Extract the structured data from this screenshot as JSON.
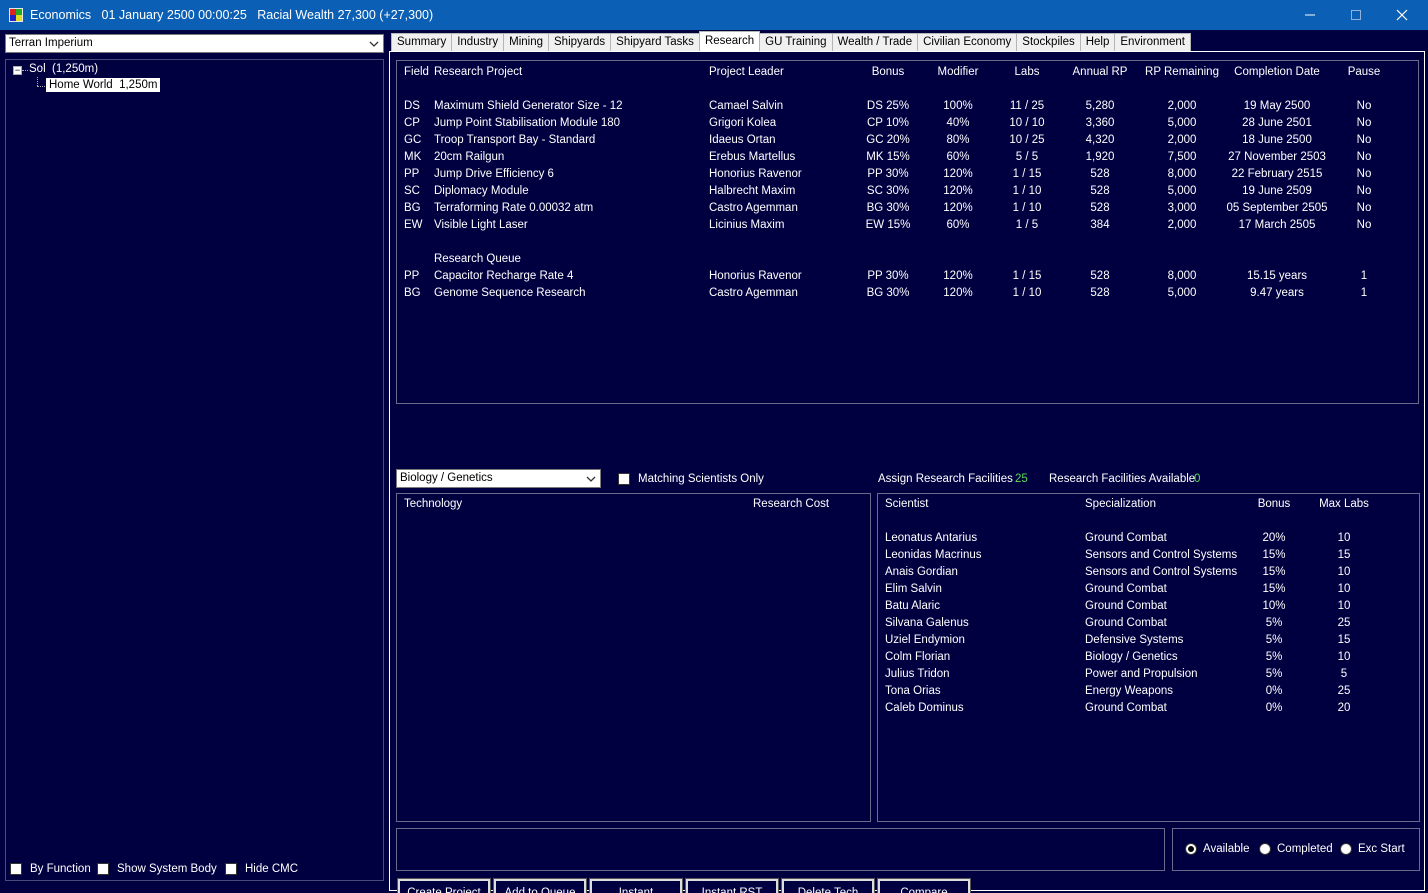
{
  "window": {
    "title": "Economics   01 January 2500 00:00:25   Racial Wealth 27,300 (+27,300)",
    "icons": [
      "app-icon",
      "minimize-icon",
      "maximize-icon",
      "close-icon"
    ]
  },
  "left": {
    "empire": "Terran Imperium",
    "tree": {
      "root_toggle": "−",
      "root": "Sol  (1,250m)",
      "child": "Home World  1,250m"
    },
    "checkboxes": {
      "by_function": "By Function",
      "show_system_body": "Show System Body",
      "hide_cmc": "Hide CMC"
    }
  },
  "tabs": [
    "Summary",
    "Industry",
    "Mining",
    "Shipyards",
    "Shipyard Tasks",
    "Research",
    "GU Training",
    "Wealth / Trade",
    "Civilian Economy",
    "Stockpiles",
    "Help",
    "Environment"
  ],
  "active_tab": "Research",
  "projects": {
    "headers": {
      "field": "Field",
      "project": "Research Project",
      "leader": "Project Leader",
      "bonus": "Bonus",
      "modifier": "Modifier",
      "labs": "Labs",
      "annual_rp": "Annual RP",
      "rp_remaining": "RP Remaining",
      "completion": "Completion Date",
      "pause": "Pause"
    },
    "rows": [
      {
        "field": "DS",
        "project": "Maximum Shield Generator Size - 12",
        "leader": "Camael Salvin",
        "bonus": "DS 25%",
        "modifier": "100%",
        "labs": "11 / 25",
        "annual_rp": "5,280",
        "rp_remaining": "2,000",
        "completion": "19 May 2500",
        "pause": "No"
      },
      {
        "field": "CP",
        "project": "Jump Point Stabilisation Module 180",
        "leader": "Grigori Kolea",
        "bonus": "CP 10%",
        "modifier": "40%",
        "labs": "10 / 10",
        "annual_rp": "3,360",
        "rp_remaining": "5,000",
        "completion": "28 June 2501",
        "pause": "No"
      },
      {
        "field": "GC",
        "project": "Troop Transport Bay - Standard",
        "leader": "Idaeus Ortan",
        "bonus": "GC 20%",
        "modifier": "80%",
        "labs": "10 / 25",
        "annual_rp": "4,320",
        "rp_remaining": "2,000",
        "completion": "18 June 2500",
        "pause": "No"
      },
      {
        "field": "MK",
        "project": "20cm Railgun",
        "leader": "Erebus Martellus",
        "bonus": "MK 15%",
        "modifier": "60%",
        "labs": "5 / 5",
        "annual_rp": "1,920",
        "rp_remaining": "7,500",
        "completion": "27 November 2503",
        "pause": "No"
      },
      {
        "field": "PP",
        "project": "Jump Drive Efficiency 6",
        "leader": "Honorius Ravenor",
        "bonus": "PP 30%",
        "modifier": "120%",
        "labs": "1 / 15",
        "annual_rp": "528",
        "rp_remaining": "8,000",
        "completion": "22 February 2515",
        "pause": "No"
      },
      {
        "field": "SC",
        "project": "Diplomacy Module",
        "leader": "Halbrecht Maxim",
        "bonus": "SC 30%",
        "modifier": "120%",
        "labs": "1 / 10",
        "annual_rp": "528",
        "rp_remaining": "5,000",
        "completion": "19 June 2509",
        "pause": "No"
      },
      {
        "field": "BG",
        "project": "Terraforming Rate 0.00032 atm",
        "leader": "Castro Agemman",
        "bonus": "BG 30%",
        "modifier": "120%",
        "labs": "1 / 10",
        "annual_rp": "528",
        "rp_remaining": "3,000",
        "completion": "05 September 2505",
        "pause": "No"
      },
      {
        "field": "EW",
        "project": "Visible Light Laser",
        "leader": "Licinius Maxim",
        "bonus": "EW 15%",
        "modifier": "60%",
        "labs": "1 / 5",
        "annual_rp": "384",
        "rp_remaining": "2,000",
        "completion": "17 March 2505",
        "pause": "No"
      }
    ],
    "queue_label": "Research Queue",
    "queue": [
      {
        "field": "PP",
        "project": "Capacitor Recharge Rate 4",
        "leader": "Honorius Ravenor",
        "bonus": "PP 30%",
        "modifier": "120%",
        "labs": "1 / 15",
        "annual_rp": "528",
        "rp_remaining": "8,000",
        "completion": "15.15 years",
        "pause": "1"
      },
      {
        "field": "BG",
        "project": "Genome Sequence Research",
        "leader": "Castro Agemman",
        "bonus": "BG 30%",
        "modifier": "120%",
        "labs": "1 / 10",
        "annual_rp": "528",
        "rp_remaining": "5,000",
        "completion": "9.47 years",
        "pause": "1"
      }
    ]
  },
  "controls": {
    "field_select": "Biology / Genetics",
    "matching_only": "Matching Scientists Only",
    "assign_label": "Assign Research Facilities",
    "assign_value": "25",
    "available_label": "Research Facilities Available",
    "available_value": "0",
    "value_color": "#55dd55"
  },
  "tech": {
    "headers": {
      "technology": "Technology",
      "cost": "Research Cost"
    },
    "rows": []
  },
  "scientists": {
    "headers": {
      "name": "Scientist",
      "spec": "Specialization",
      "bonus": "Bonus",
      "max_labs": "Max Labs"
    },
    "rows": [
      {
        "name": "Leonatus Antarius",
        "spec": "Ground Combat",
        "bonus": "20%",
        "max_labs": "10"
      },
      {
        "name": "Leonidas Macrinus",
        "spec": "Sensors and Control Systems",
        "bonus": "15%",
        "max_labs": "15"
      },
      {
        "name": "Anais Gordian",
        "spec": "Sensors and Control Systems",
        "bonus": "15%",
        "max_labs": "10"
      },
      {
        "name": "Elim Salvin",
        "spec": "Ground Combat",
        "bonus": "15%",
        "max_labs": "10"
      },
      {
        "name": "Batu Alaric",
        "spec": "Ground Combat",
        "bonus": "10%",
        "max_labs": "10"
      },
      {
        "name": "Silvana Galenus",
        "spec": "Ground Combat",
        "bonus": "5%",
        "max_labs": "25"
      },
      {
        "name": "Uziel Endymion",
        "spec": "Defensive Systems",
        "bonus": "5%",
        "max_labs": "15"
      },
      {
        "name": "Colm Florian",
        "spec": "Biology / Genetics",
        "bonus": "5%",
        "max_labs": "10"
      },
      {
        "name": "Julius Tridon",
        "spec": "Power and Propulsion",
        "bonus": "5%",
        "max_labs": "5"
      },
      {
        "name": "Tona Orias",
        "spec": "Energy Weapons",
        "bonus": "0%",
        "max_labs": "25"
      },
      {
        "name": "Caleb Dominus",
        "spec": "Ground Combat",
        "bonus": "0%",
        "max_labs": "20"
      }
    ]
  },
  "radios": {
    "available": "Available",
    "completed": "Completed",
    "exc_start": "Exc Start",
    "selected": "available"
  },
  "buttons": {
    "create_project": "Create Project",
    "add_to_queue": "Add to Queue",
    "instant": "Instant",
    "instant_rst": "Instant RST",
    "delete_tech": "Delete Tech",
    "compare": "Compare"
  }
}
